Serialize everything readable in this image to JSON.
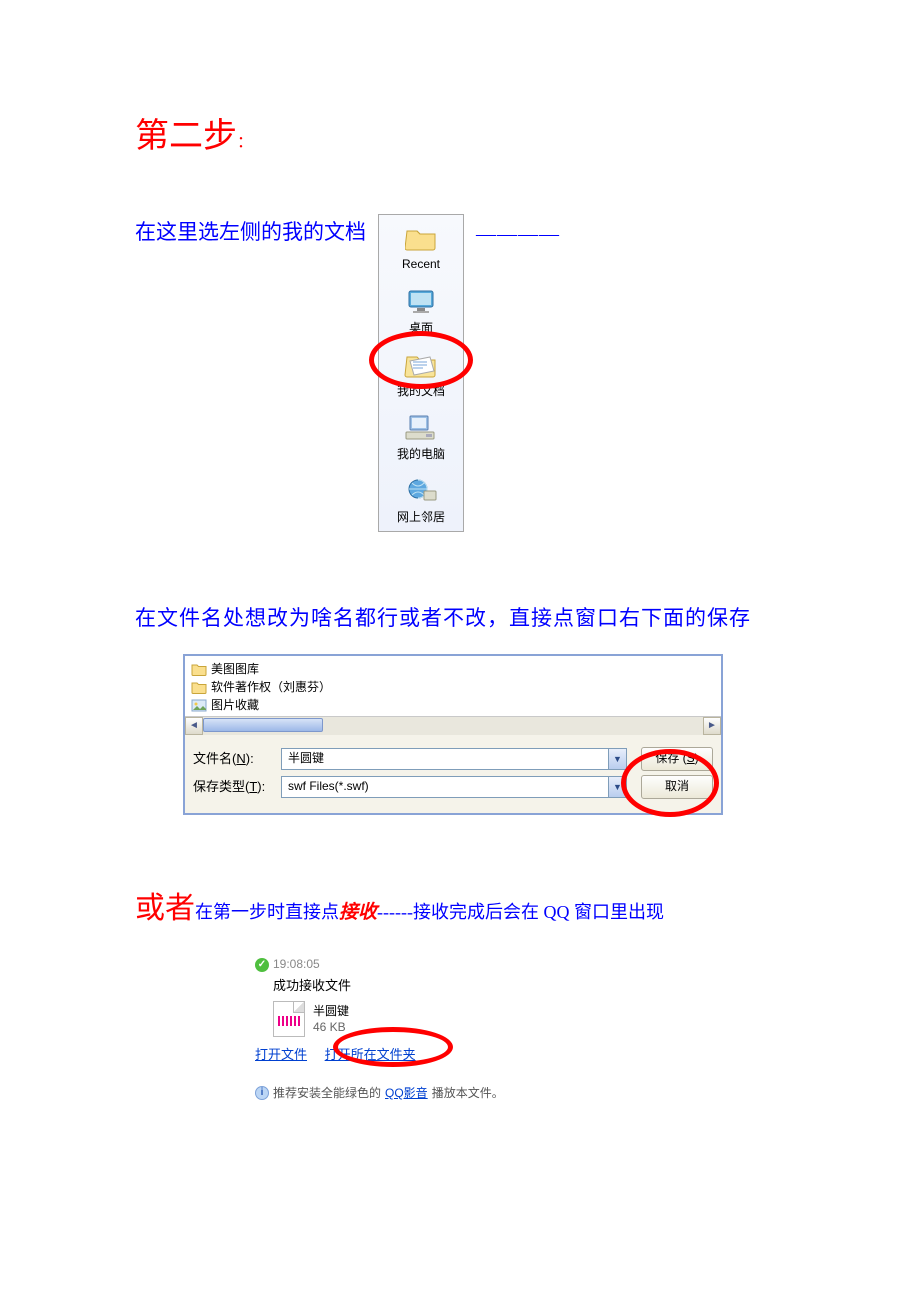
{
  "step": {
    "title": "第二步",
    "colon": "："
  },
  "instr1": {
    "text": "在这里选左侧的我的文档",
    "dashes": "————"
  },
  "sidebar": {
    "items": [
      {
        "label": "Recent"
      },
      {
        "label": "桌面"
      },
      {
        "label": "我的文档"
      },
      {
        "label": "我的电脑"
      },
      {
        "label": "网上邻居"
      }
    ]
  },
  "instr2": {
    "text": "在文件名处想改为啥名都行或者不改，直接点窗口右下面的保存"
  },
  "save_dialog": {
    "folders": [
      "美图图库",
      "软件著作权（刘惠芬）",
      "图片收藏"
    ],
    "filename_label_pre": "文件名(",
    "filename_label_u": "N",
    "filename_label_post": "):",
    "filetype_label_pre": "保存类型(",
    "filetype_label_u": "T",
    "filetype_label_post": "):",
    "filename_value": "半圆键",
    "filetype_value": "swf Files(*.swf)",
    "save_btn_pre": "保存 (",
    "save_btn_u": "S",
    "save_btn_post": ")",
    "cancel_btn": "取消"
  },
  "alt": {
    "or": "或者",
    "body1": "在第一步时直接点",
    "accept": "接收",
    "dashes": "------",
    "body2": "接收完成后会在 QQ 窗口里出现"
  },
  "qq": {
    "time": "19:08:05",
    "status": "成功接收文件",
    "filename": "半圆键",
    "filesize": "46 KB",
    "link_open_file": "打开文件",
    "link_open_folder": "打开所在文件夹",
    "reco_pre": "推荐安装全能绿色的",
    "reco_link": "QQ影音",
    "reco_post": "播放本文件。"
  }
}
